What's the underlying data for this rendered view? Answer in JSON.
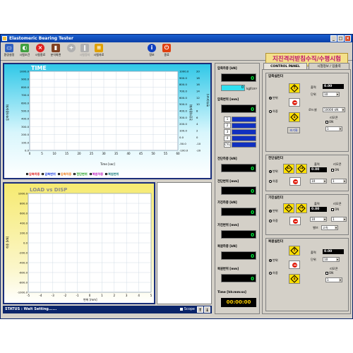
{
  "window": {
    "title": "Elastomeric Bearing Tester"
  },
  "toolbar": {
    "buttons": [
      {
        "label": "환경설정",
        "icon": "monitor-icon",
        "color": "#3060c0"
      },
      {
        "label": "시험조건",
        "icon": "palette-icon",
        "color": "#40a040"
      },
      {
        "label": "시험종료",
        "icon": "close-icon",
        "color": "#e02020"
      },
      {
        "label": "분석화면",
        "icon": "bar-chart-icon",
        "color": "#804020"
      },
      {
        "label": "시험정지",
        "icon": "pause-icon",
        "color": "#909090"
      },
      {
        "label": "시험자료",
        "icon": "data-icon",
        "color": "#e0a000"
      },
      {
        "label": "정보",
        "icon": "info-icon",
        "color": "#1040c0"
      },
      {
        "label": "종료",
        "icon": "power-icon",
        "color": "#e04010"
      }
    ]
  },
  "banner": "지진격리받침수직/수평시험",
  "time_chart": {
    "title": "TIME",
    "xlabel": "Time [sec]",
    "ylabel_left": "압축하중(kN)",
    "ylabel_right_1": "전단하중(kN)",
    "ylabel_right_2": "변위(mm)",
    "xticks": [
      "0",
      "5",
      "10",
      "15",
      "20",
      "25",
      "30",
      "35",
      "40",
      "45",
      "50",
      "55",
      "60"
    ],
    "yticks_left": [
      "1000.0",
      "900.0",
      "800.0",
      "700.0",
      "600.0",
      "500.0",
      "400.0",
      "300.0",
      "200.0",
      "100.0",
      "0.0"
    ],
    "yticks_right_1": [
      "1000.0",
      "900.0",
      "800.0",
      "700.0",
      "600.0",
      "500.0",
      "400.0",
      "300.0",
      "200.0",
      "100.0",
      "0.0",
      "-50.0",
      "-100.0"
    ],
    "yticks_right_2": [
      "20",
      "18",
      "16",
      "14",
      "12",
      "10",
      "8",
      "6",
      "4",
      "2",
      "0",
      "-10",
      "-20"
    ],
    "legend": [
      "압축하중",
      "압축변위",
      "압축하중",
      "전단변위",
      "복원하중",
      "복원변위"
    ]
  },
  "load_disp_chart": {
    "title": "LOAD vs DISP",
    "xlabel": "변위 [mm]",
    "ylabel": "하중 [kN]",
    "xticks": [
      "-5",
      "-4",
      "-3",
      "-2",
      "-1",
      "0",
      "1",
      "2",
      "3",
      "4",
      "5"
    ],
    "yticks": [
      "1000.0",
      "800.0",
      "600.0",
      "400.0",
      "200.0",
      "0.0",
      "-200.0",
      "-400.0",
      "-600.0",
      "-800.0",
      "-1000.0"
    ]
  },
  "status": {
    "text": "STATUS : Wait Setting......",
    "scope_label": "Scope"
  },
  "meters": {
    "compress_load_label": "압축하중 [kN]",
    "compress_load_value": "0",
    "stress_value": "0",
    "stress_unit": "kgf/cm²",
    "compress_disp_label": "압축변위 [mm]",
    "compress_disp_value": "0",
    "rows": [
      "1",
      "2",
      "3",
      "4",
      "CYL"
    ],
    "shear_load_label": "전단하중 [kN]",
    "shear_load_value": "0",
    "shear_disp_label": "전단변위 [mm]",
    "shear_disp_value": "0",
    "add_load_label": "가진하중 [kN]",
    "add_load_value": "0",
    "add_disp_label": "가진변위 [mm]",
    "add_disp_value": "0",
    "restore_load_label": "복원하중 [kN]",
    "restore_load_value": "0",
    "restore_disp_label": "복원변위 [mm]",
    "restore_disp_value": "0",
    "time_label": "Time [hh:mm:ss]",
    "time_value": "00:00:00"
  },
  "tabs": [
    "CONTROL PANEL",
    "시험정보 / 입출력"
  ],
  "control": {
    "compress": {
      "title": "압축실린더",
      "output_label": "출력",
      "output_value": "0.00",
      "unit_label": "단위",
      "unit_value": "10",
      "load_label": "로드셀",
      "load_value": "10000 kN",
      "remote_label": "리모콘",
      "remote_value": "ON",
      "remote_num": "1",
      "radio_disp": "변위",
      "radio_load": "하중",
      "init_label": "초기화"
    },
    "shear": {
      "title": "전단실린더",
      "output_label": "출력",
      "output_value": "0.00",
      "remote_label": "리모콘",
      "remote_value": "ON",
      "sel_1": "10",
      "sel_2": "1",
      "radio_disp": "변위",
      "radio_load": "하중"
    },
    "excite": {
      "title": "가진실린더",
      "output_label": "출력",
      "output_value": "0.00",
      "remote_label": "리모콘",
      "remote_value": "ON",
      "sel_1": "10",
      "sel_2": "1",
      "speed_label": "밸브",
      "speed_value": "고속",
      "radio_disp": "변위",
      "radio_load": "하중"
    },
    "restore": {
      "title": "복원실린더",
      "output_label": "출력",
      "output_value": "0.00",
      "unit_label": "단위",
      "unit_value": "10",
      "remote_label": "리모콘",
      "remote_value": "ON",
      "remote_num": "1",
      "radio_disp": "변위",
      "radio_load": "하중"
    }
  }
}
